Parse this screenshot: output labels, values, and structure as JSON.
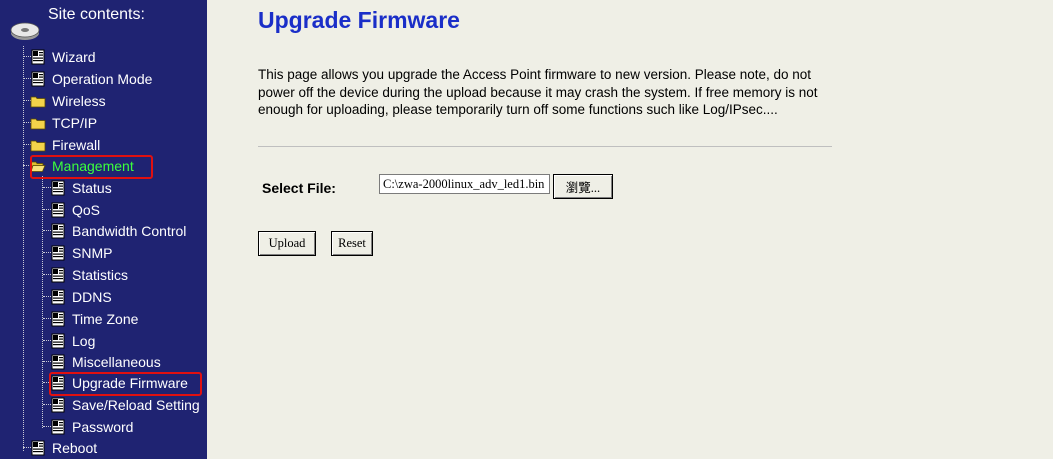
{
  "sidebar": {
    "header": "Site contents:",
    "items": [
      {
        "label": "Wizard",
        "icon": "page-icon"
      },
      {
        "label": "Operation Mode",
        "icon": "page-icon"
      },
      {
        "label": "Wireless",
        "icon": "folder-icon"
      },
      {
        "label": "TCP/IP",
        "icon": "folder-icon"
      },
      {
        "label": "Firewall",
        "icon": "folder-icon"
      },
      {
        "label": "Management",
        "icon": "open-folder-icon"
      },
      {
        "label": "Status",
        "icon": "page-icon"
      },
      {
        "label": "QoS",
        "icon": "page-icon"
      },
      {
        "label": "Bandwidth Control",
        "icon": "page-icon"
      },
      {
        "label": "SNMP",
        "icon": "page-icon"
      },
      {
        "label": "Statistics",
        "icon": "page-icon"
      },
      {
        "label": "DDNS",
        "icon": "page-icon"
      },
      {
        "label": "Time Zone",
        "icon": "page-icon"
      },
      {
        "label": "Log",
        "icon": "page-icon"
      },
      {
        "label": "Miscellaneous",
        "icon": "page-icon"
      },
      {
        "label": "Upgrade Firmware",
        "icon": "page-icon"
      },
      {
        "label": "Save/Reload Setting",
        "icon": "page-icon"
      },
      {
        "label": "Password",
        "icon": "page-icon"
      },
      {
        "label": "Reboot",
        "icon": "page-icon"
      }
    ]
  },
  "main": {
    "title": "Upgrade Firmware",
    "description": "This page allows you upgrade the Access Point firmware to new version. Please note, do not power off the device during the upload because it may crash the system. If free memory is not enough for uploading, please temporarily turn off some functions such like Log/IPsec....",
    "select_file_label": "Select File:",
    "file_value": "C:\\zwa-2000linux_adv_led1.bin",
    "browse_label": "瀏覽...",
    "upload_label": "Upload",
    "reset_label": "Reset"
  },
  "colors": {
    "sidebar_bg": "#1f2372",
    "content_bg": "#efefe6",
    "title": "#1a2ec8",
    "active_item": "#3cff3c",
    "highlight": "#e01010"
  }
}
